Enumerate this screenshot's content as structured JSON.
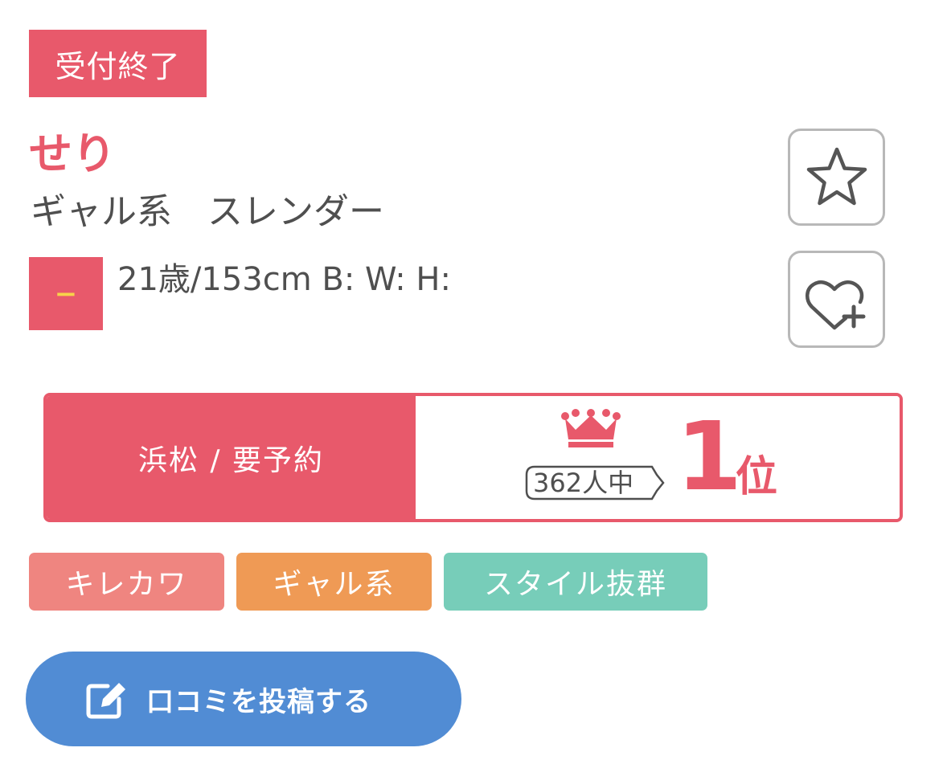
{
  "profile": {
    "status_badge": "受付終了",
    "name": "せり",
    "types": "ギャル系　スレンダー",
    "minus_badge": "−",
    "stats": "21歳/153cm B: W: H:"
  },
  "actions": {
    "favorite_icon": "star-icon",
    "follow_icon": "heart-plus-icon"
  },
  "ranking": {
    "area_label": "浜松 / 要予約",
    "total": "362人中",
    "rank": "1",
    "rank_suffix": "位"
  },
  "tags": [
    "キレカワ",
    "ギャル系",
    "スタイル抜群"
  ],
  "review": {
    "label": "口コミを投稿する",
    "icon": "edit-icon"
  },
  "colors": {
    "accent": "#e8596b",
    "tag_1": "#ef8580",
    "tag_2": "#ef9a55",
    "tag_3": "#77cdb9",
    "button": "#518cd4"
  }
}
